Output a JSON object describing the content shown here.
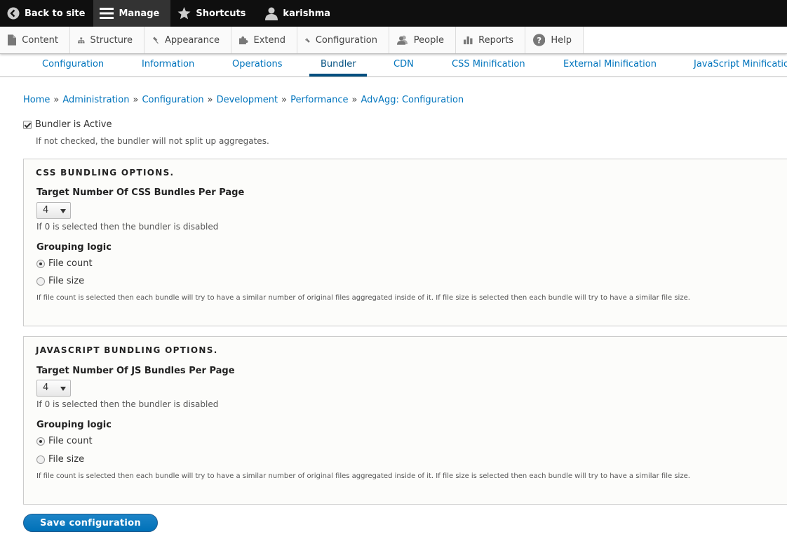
{
  "toolbar": {
    "back": "Back to site",
    "manage": "Manage",
    "shortcuts": "Shortcuts",
    "user": "karishma"
  },
  "tray": {
    "items": [
      "Content",
      "Structure",
      "Appearance",
      "Extend",
      "Configuration",
      "People",
      "Reports",
      "Help"
    ]
  },
  "tabs": [
    "Configuration",
    "Information",
    "Operations",
    "Bundler",
    "CDN",
    "CSS Minification",
    "External Minification",
    "JavaScript Minification"
  ],
  "breadcrumb": [
    "Home",
    "Administration",
    "Configuration",
    "Development",
    "Performance",
    "AdvAgg: Configuration"
  ],
  "breadcrumb_sep": "»",
  "bundler": {
    "label": "Bundler is Active",
    "checked": true,
    "description": "If not checked, the bundler will not split up aggregates."
  },
  "css": {
    "legend": "CSS BUNDLING OPTIONS.",
    "target_label": "Target Number Of CSS Bundles Per Page",
    "target_value": "4",
    "target_desc": "If 0 is selected then the bundler is disabled",
    "grouping_label": "Grouping logic",
    "option_count": "File count",
    "option_size": "File size",
    "grouping_desc": "If file count is selected then each bundle will try to have a similar number of original files aggregated inside of it. If file size is selected then each bundle will try to have a similar file size."
  },
  "js": {
    "legend": "JAVASCRIPT BUNDLING OPTIONS.",
    "target_label": "Target Number Of JS Bundles Per Page",
    "target_value": "4",
    "target_desc": "If 0 is selected then the bundler is disabled",
    "grouping_label": "Grouping logic",
    "option_count": "File count",
    "option_size": "File size",
    "grouping_desc": "If file count is selected then each bundle will try to have a similar number of original files aggregated inside of it. If file size is selected then each bundle will try to have a similar file size."
  },
  "save_label": "Save configuration",
  "colors": {
    "link": "#0074bd",
    "active_tab": "#004f80",
    "button": "#0071b8",
    "toolbar": "#0f0f0f"
  }
}
